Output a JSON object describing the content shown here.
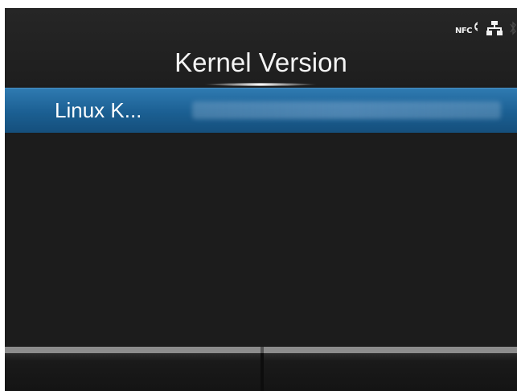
{
  "status_bar": {
    "nfc_label": "NFC",
    "icons": [
      "nfc-icon",
      "network-icon",
      "bluetooth-icon"
    ]
  },
  "header": {
    "title": "Kernel Version"
  },
  "list": {
    "items": [
      {
        "label": "Linux K...",
        "value_obscured": true
      }
    ]
  },
  "softkeys": [
    {
      "label": ""
    },
    {
      "label": ""
    }
  ],
  "colors": {
    "background": "#1c1c1c",
    "selection": "#1b5f92",
    "text": "#f4f4f4",
    "softkey_border": "#8c8c8c"
  }
}
